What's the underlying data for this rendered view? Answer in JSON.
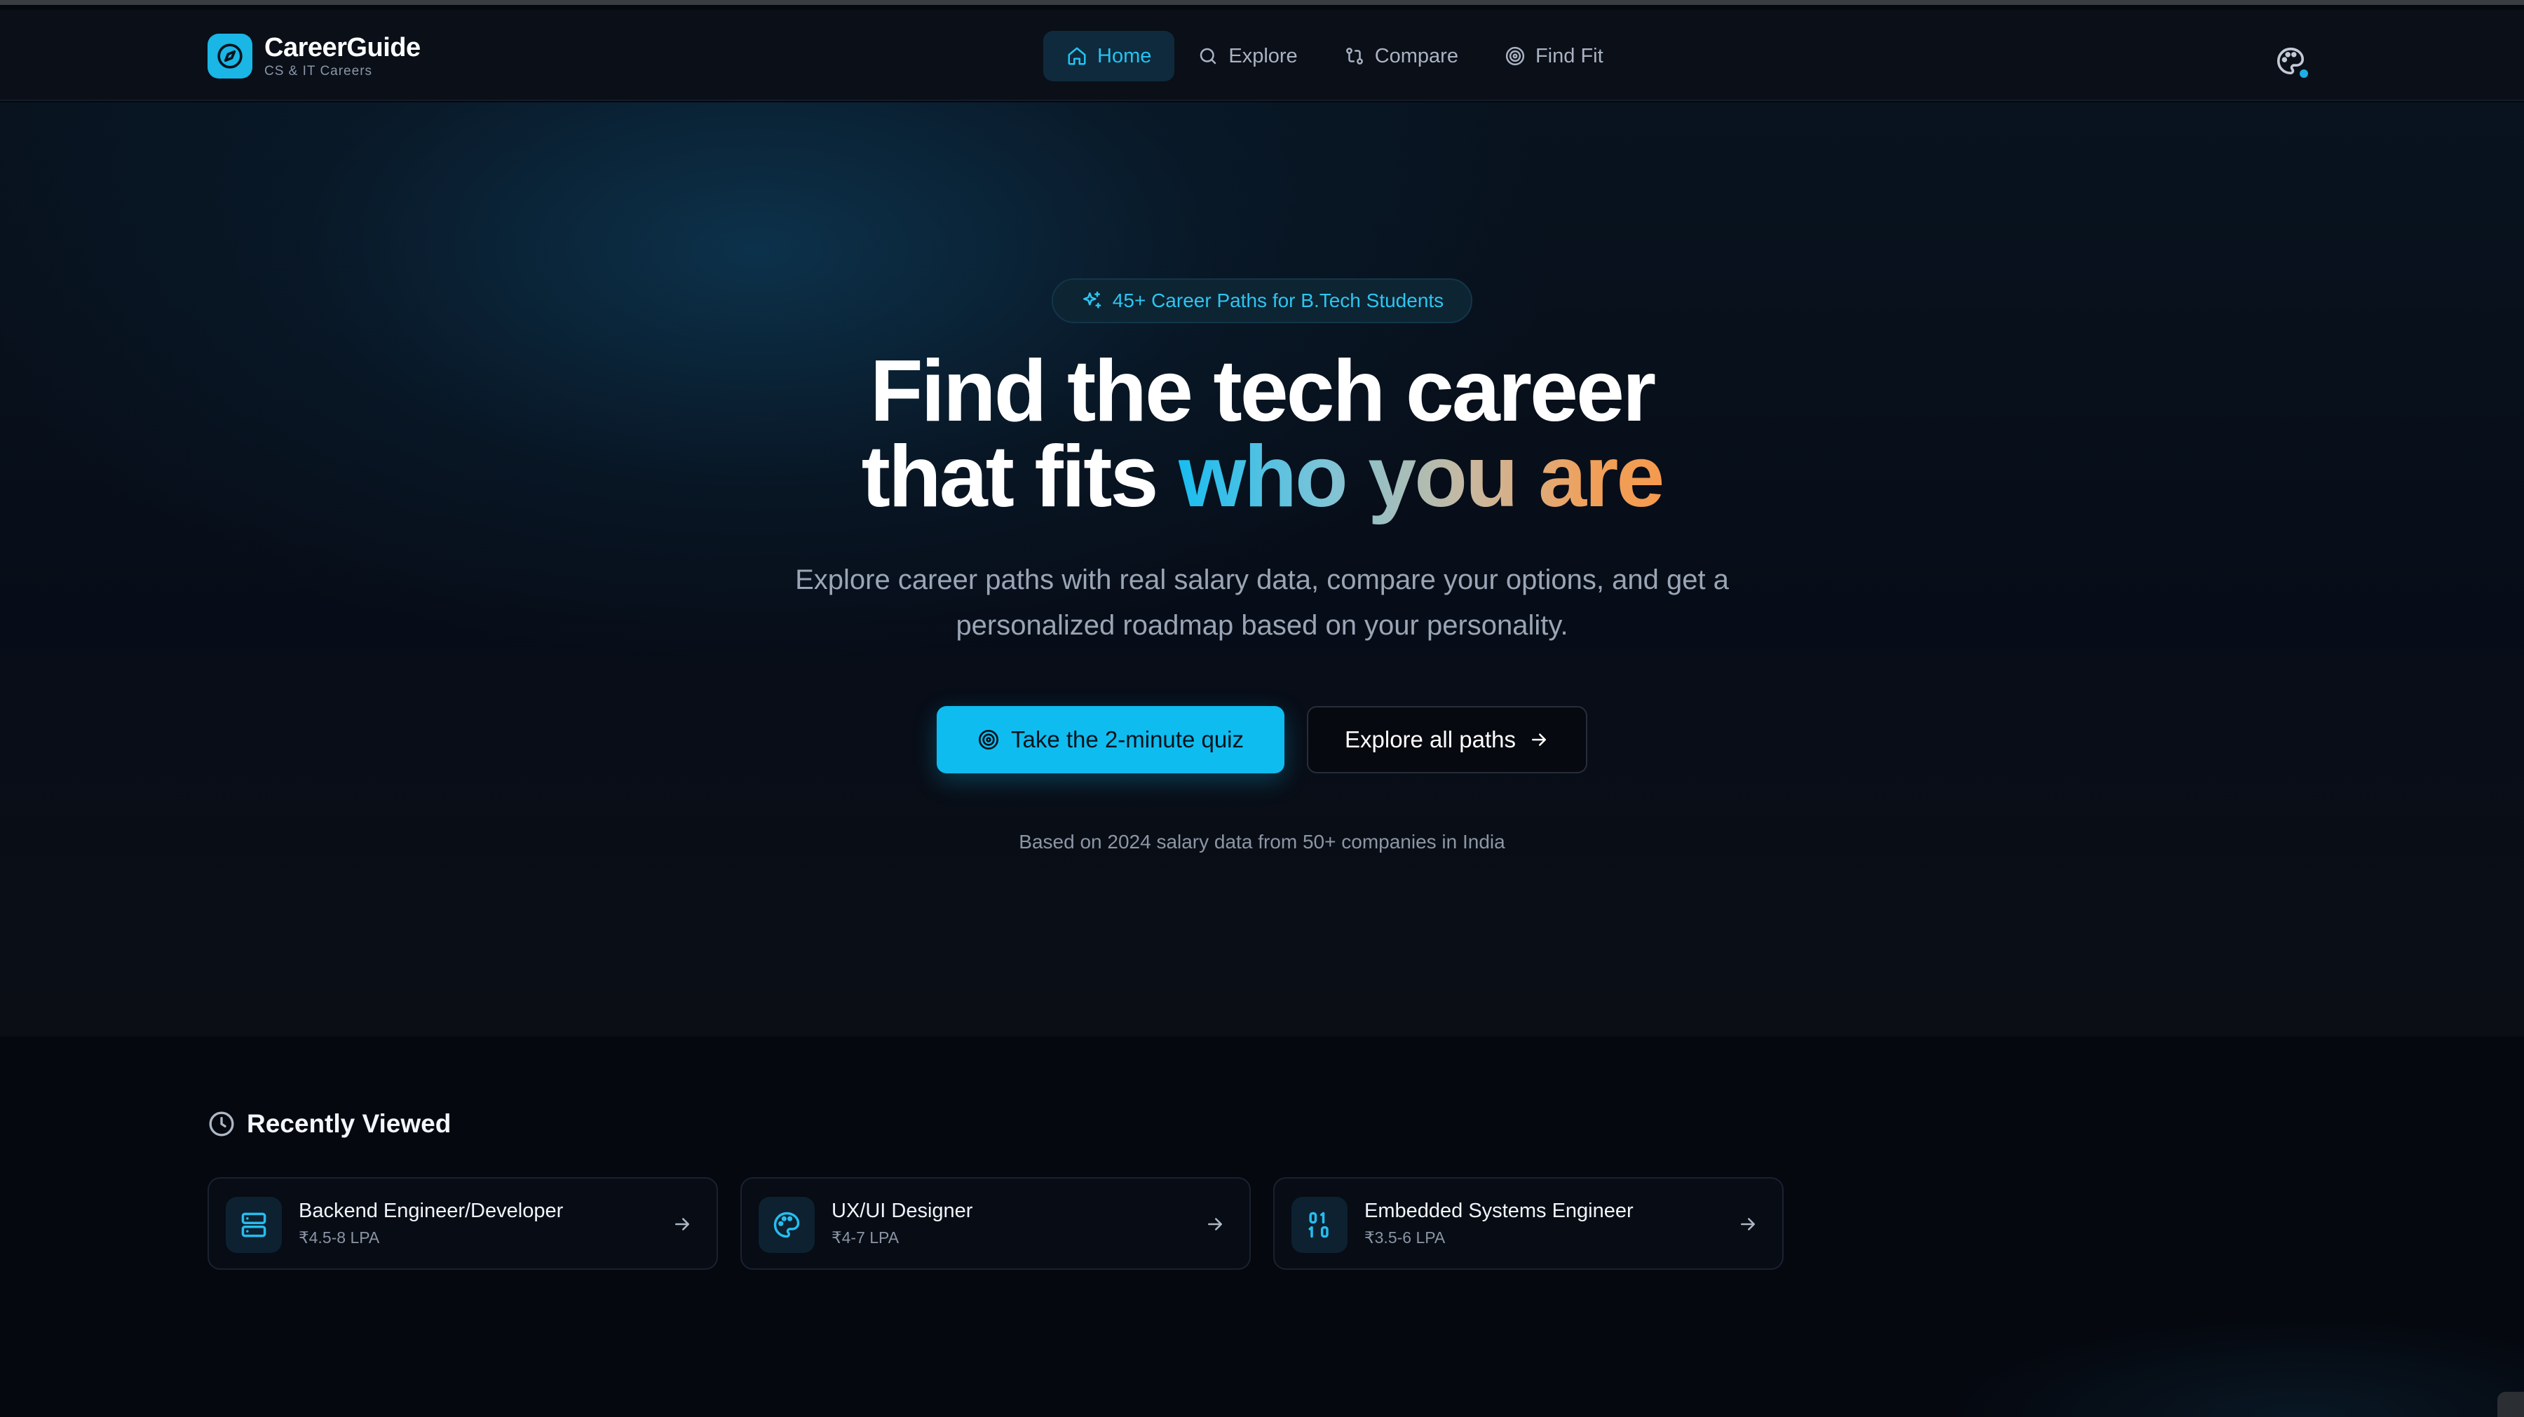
{
  "brand": {
    "name": "CareerGuide",
    "subtitle": "CS & IT Careers",
    "logo_icon": "compass-icon",
    "accent": "#19b6e6"
  },
  "nav": {
    "items": [
      {
        "label": "Home",
        "icon": "home-icon",
        "active": true
      },
      {
        "label": "Explore",
        "icon": "search-icon",
        "active": false
      },
      {
        "label": "Compare",
        "icon": "compare-icon",
        "active": false
      },
      {
        "label": "Find Fit",
        "icon": "target-icon",
        "active": false
      }
    ],
    "theme_icon": "palette-icon"
  },
  "hero": {
    "badge": "45+ Career Paths for B.Tech Students",
    "headline_line1": "Find the tech career",
    "headline_line2_plain": "that fits",
    "headline_line2_gradient": "who you are",
    "subtitle": "Explore career paths with real salary data, compare your options, and get a personalized roadmap based on your personality.",
    "primary_cta": "Take the 2-minute quiz",
    "secondary_cta": "Explore all paths",
    "footnote": "Based on 2024 salary data from 50+ companies in India"
  },
  "recently_viewed": {
    "title": "Recently Viewed",
    "items": [
      {
        "name": "Backend Engineer/Developer",
        "salary": "₹4.5-8 LPA",
        "icon": "server-icon"
      },
      {
        "name": "UX/UI Designer",
        "salary": "₹4-7 LPA",
        "icon": "palette-icon"
      },
      {
        "name": "Embedded Systems Engineer",
        "salary": "₹3.5-6 LPA",
        "icon": "binary-icon"
      }
    ]
  },
  "colors": {
    "background": "#05080f",
    "primary_button": "#0fbcef",
    "gradient_start": "#19bdf0",
    "gradient_end": "#f59a4f"
  }
}
